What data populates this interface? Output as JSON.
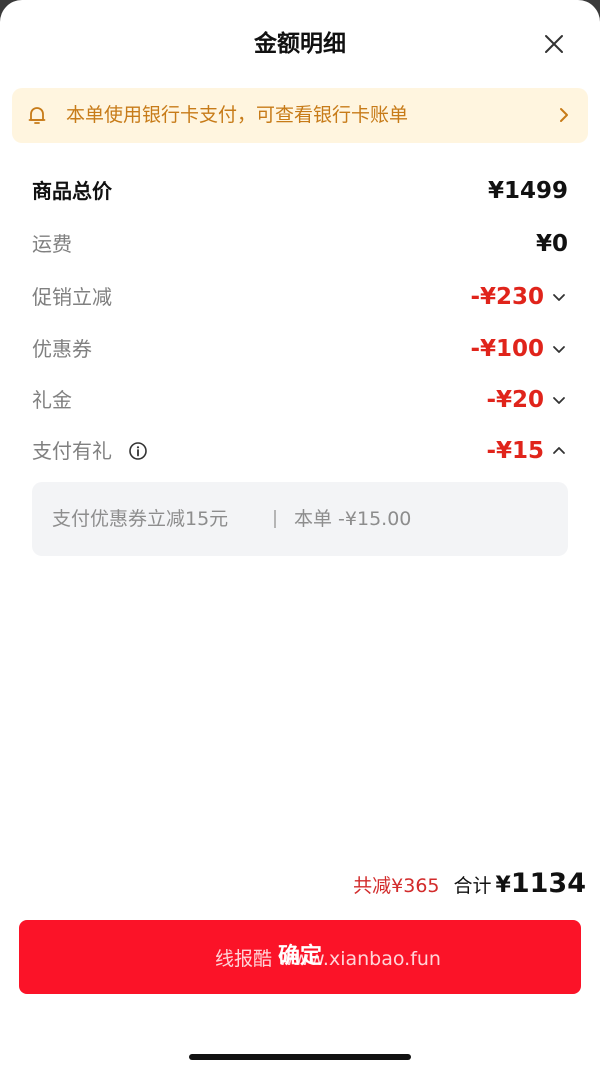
{
  "header": {
    "title": "金额明细"
  },
  "notice": {
    "text": "本单使用银行卡支付，可查看银行卡账单"
  },
  "rows": [
    {
      "label": "商品总价",
      "amount": "¥1499"
    },
    {
      "label": "运费",
      "amount": "¥0"
    },
    {
      "label": "促销立减",
      "amount": "-¥230"
    },
    {
      "label": "优惠券",
      "amount": "-¥100"
    },
    {
      "label": "礼金",
      "amount": "-¥20"
    },
    {
      "label": "支付有礼",
      "amount": "-¥15"
    }
  ],
  "detail": {
    "text": "支付优惠券立减15元",
    "value": "本单 -¥15.00"
  },
  "summary": {
    "discount": "共减¥365",
    "total_label": "合计",
    "currency": "¥",
    "total": "1134"
  },
  "confirm": {
    "label": "确定",
    "watermark": "线报酷 www.xianbao.fun"
  },
  "colors": {
    "accent_red": "#fb1328",
    "discount_red": "#e0241b",
    "notice_bg": "#fff5df",
    "notice_text": "#c77b18"
  },
  "icons": {
    "close": "close-icon",
    "notice": "bell-icon",
    "notice_arrow": "chevron-right-icon",
    "expand": "chevron-down-icon",
    "collapse": "chevron-up-icon",
    "info": "info-icon"
  }
}
